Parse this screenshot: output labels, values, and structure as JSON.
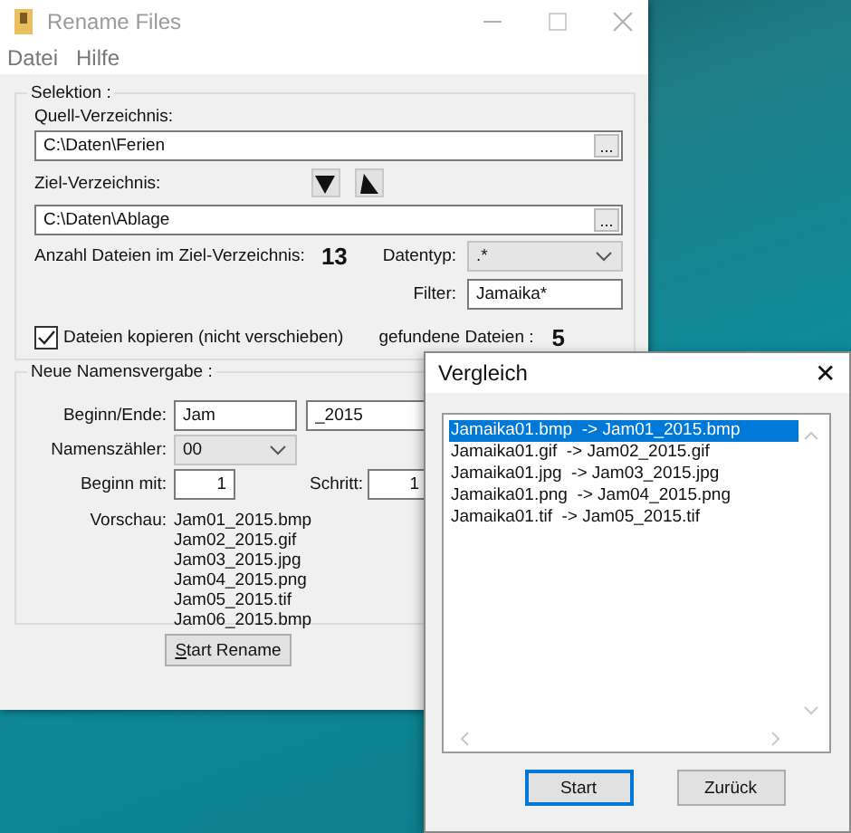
{
  "main_window": {
    "title": "Rename Files",
    "menu": [
      "Datei",
      "Hilfe"
    ],
    "selection": {
      "title": "Selektion :",
      "source_label": "Quell-Verzeichnis:",
      "source_path": "C:\\Daten\\Ferien",
      "browse_label": "...",
      "target_label": "Ziel-Verzeichnis:",
      "target_path": "C:\\Daten\\Ablage",
      "target_browse_label": "...",
      "count_label": "Anzahl Dateien im Ziel-Verzeichnis:",
      "count_value": "13",
      "type_label": "Datentyp:",
      "type_value": ".*",
      "filter_label": "Filter:",
      "filter_value": "Jamaika*",
      "copy": {
        "label": "Dateien kopieren (nicht verschieben)",
        "checked": true
      },
      "found_label": "gefundene Dateien :",
      "found_value": "5"
    },
    "naming": {
      "title": "Neue Namensvergabe :",
      "begin_end_label": "Beginn/Ende:",
      "begin_value": "Jam",
      "end_value": "_2015",
      "counter_label": "Namenszähler:",
      "counter_value": "00",
      "start_label": "Beginn mit:",
      "start_value": "1",
      "step_label": "Schritt:",
      "step_value": "1",
      "preview_label": "Vorschau:",
      "preview": [
        "Jam01_2015.bmp",
        "Jam02_2015.gif",
        "Jam03_2015.jpg",
        "Jam04_2015.png",
        "Jam05_2015.tif",
        "Jam06_2015.bmp"
      ]
    },
    "start_button": "Start Rename"
  },
  "dialog": {
    "title": "Vergleich",
    "close": "✕",
    "items": [
      {
        "text": "Jamaika01.bmp  -> Jam01_2015.bmp",
        "selected": true
      },
      {
        "text": "Jamaika01.gif  -> Jam02_2015.gif",
        "selected": false
      },
      {
        "text": "Jamaika01.jpg  -> Jam03_2015.jpg",
        "selected": false
      },
      {
        "text": "Jamaika01.png  -> Jam04_2015.png",
        "selected": false
      },
      {
        "text": "Jamaika01.tif  -> Jam05_2015.tif",
        "selected": false
      }
    ],
    "buttons": [
      {
        "label": "Start",
        "default": true
      },
      {
        "label": "Zurück",
        "default": false
      }
    ]
  }
}
